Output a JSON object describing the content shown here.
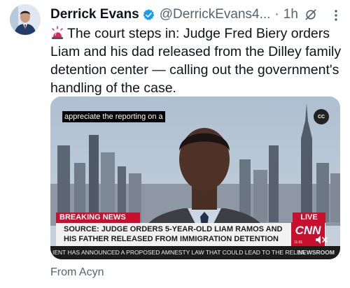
{
  "tweet": {
    "author_name": "Derrick Evans",
    "author_handle": "@DerrickEvans4...",
    "separator": "·",
    "time": "1h",
    "verified_icon": "verified-badge-icon",
    "grok_icon": "grok-icon",
    "more_icon": "more-vertical-icon",
    "text_emoji": "siren-emoji",
    "text": "The court steps in: Judge Fred Biery orders Liam and his dad released from the Dilley family detention center — calling out the government's handling of the case.",
    "from": "From Acyn"
  },
  "video": {
    "caption": "appreciate the reporting on a",
    "cc_label": "CC",
    "breaking_label": "BREAKING NEWS",
    "live_label": "LIVE",
    "headline_line1": "SOURCE: JUDGE ORDERS 5-YEAR-OLD LIAM RAMOS AND",
    "headline_line2": "HIS FATHER RELEASED FROM IMMIGRATION DETENTION",
    "network": "CNN",
    "network_time": "11:01",
    "ticker": "IENT HAS ANNOUNCED A PROPOSED AMNESTY LAW THAT COULD LEAD TO THE RELEA",
    "ticker_brand": "NEWSROOM",
    "mute_icon": "mute-icon"
  },
  "colors": {
    "brand_blue": "#1d9bf0",
    "cnn_red": "#c8102e",
    "secondary_text": "#536471"
  }
}
